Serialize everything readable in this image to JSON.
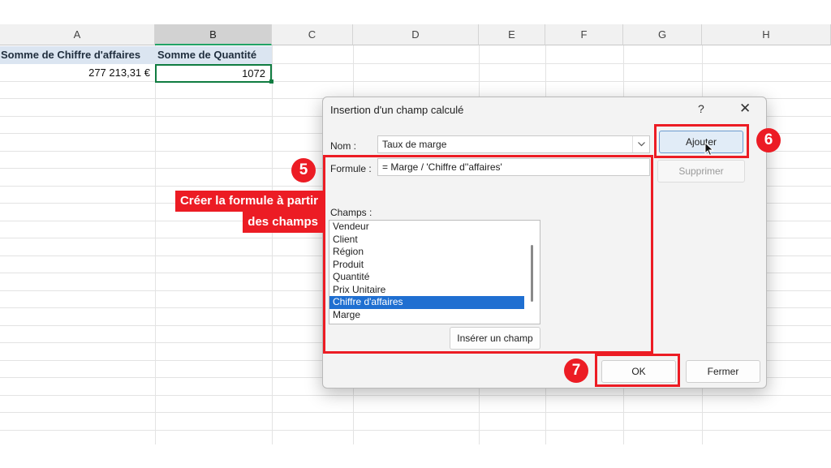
{
  "sheet": {
    "columns": [
      "A",
      "B",
      "C",
      "D",
      "E",
      "F",
      "G",
      "H"
    ],
    "header_a": "Somme de Chiffre d'affaires",
    "header_b": "Somme de Quantité",
    "value_a": "277 213,31 €",
    "value_b": "1072"
  },
  "dialog": {
    "title": "Insertion d'un champ calculé",
    "help": "?",
    "close": "✕",
    "nom_label": "Nom :",
    "nom_value": "Taux de marge",
    "formule_label": "Formule :",
    "formule_value": "= Marge / 'Chiffre d''affaires'",
    "champs_label": "Champs :",
    "fields": [
      "Vendeur",
      "Client",
      "Région",
      "Produit",
      "Quantité",
      "Prix Unitaire",
      "Chiffre d'affaires",
      "Marge"
    ],
    "selected_field": "Chiffre d'affaires",
    "ajouter": "Ajouter",
    "supprimer": "Supprimer",
    "inserer": "Insérer un champ",
    "ok": "OK",
    "fermer": "Fermer"
  },
  "annotations": {
    "step5": "5",
    "step6": "6",
    "step7": "7",
    "callout_line1": "Créer la formule à partir",
    "callout_line2": "des champs"
  },
  "colors": {
    "accent_red": "#ec1c24",
    "selection_blue": "#1f6fd1",
    "excel_green": "#107c41"
  },
  "icons": {
    "dropdown": "chevron-down-icon",
    "cursor": "mouse-pointer-icon"
  }
}
